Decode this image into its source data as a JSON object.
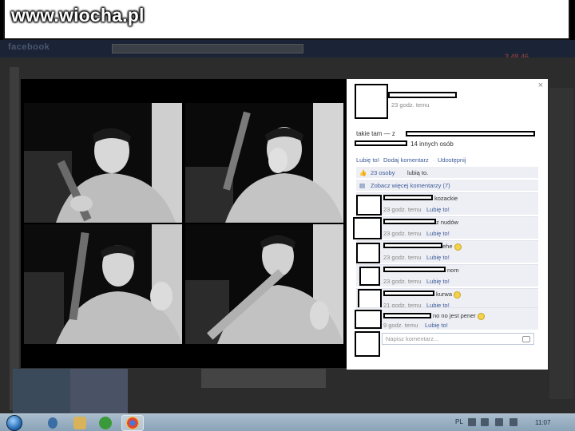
{
  "watermark": {
    "text": "www.wiocha.pl"
  },
  "facebook": {
    "logo": "facebook",
    "notification_count": "3 48 46"
  },
  "post": {
    "time": "23 godz. temu",
    "caption": "takie tam — z",
    "tagged_others": "14 innych osób",
    "actions": {
      "like": "Lubię to!",
      "comment": "Dodaj komentarz",
      "share": "Udostępnij"
    },
    "likes_text": "23 osoby",
    "likes_suffix": "lubią to.",
    "view_more": "Zobacz więcej komentarzy (7)"
  },
  "comments": [
    {
      "text": "kozackie",
      "time": "23 godz. temu",
      "like": "Lubię to!"
    },
    {
      "text": "z nudów",
      "time": "23 godz. temu",
      "like": "Lubię to!"
    },
    {
      "text": "ehe",
      "time": "23 godz. temu",
      "like": "Lubię to!",
      "emoji": true
    },
    {
      "text": "nom",
      "time": "23 godz. temu",
      "like": "Lubię to!"
    },
    {
      "text": "kurwa",
      "time": "21 godz. temu",
      "like": "Lubię to!",
      "emoji": true
    },
    {
      "text": "no no jest pener",
      "time": "9 godz. temu",
      "like": "Lubię to!",
      "emoji": true
    }
  ],
  "comment_input": {
    "placeholder": "Napisz komentarz..."
  },
  "taskbar": {
    "language": "PL",
    "clock": "11:07"
  },
  "colors": {
    "link": "#3b5998",
    "taskbar": "#8aa3b8",
    "fb_header": "#1a2436"
  }
}
